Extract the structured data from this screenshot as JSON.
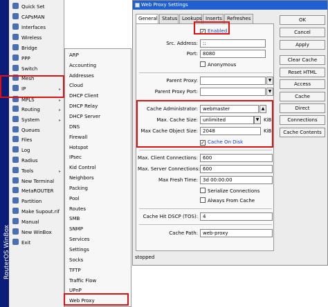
{
  "brand": {
    "text": "RouterOS WinBox"
  },
  "sidebar": {
    "items": [
      {
        "label": "Quick Set",
        "icon": "quick-set-icon"
      },
      {
        "label": "CAPsMAN",
        "icon": "capsman-icon"
      },
      {
        "label": "Interfaces",
        "icon": "interfaces-icon"
      },
      {
        "label": "Wireless",
        "icon": "wireless-icon"
      },
      {
        "label": "Bridge",
        "icon": "bridge-icon"
      },
      {
        "label": "PPP",
        "icon": "ppp-icon"
      },
      {
        "label": "Switch",
        "icon": "switch-icon"
      },
      {
        "label": "Mesh",
        "icon": "mesh-icon"
      },
      {
        "label": "IP",
        "icon": "ip-icon",
        "submenu": true
      },
      {
        "label": "MPLS",
        "icon": "mpls-icon",
        "submenu": true
      },
      {
        "label": "Routing",
        "icon": "routing-icon",
        "submenu": true
      },
      {
        "label": "System",
        "icon": "system-icon",
        "submenu": true
      },
      {
        "label": "Queues",
        "icon": "queues-icon"
      },
      {
        "label": "Files",
        "icon": "files-icon"
      },
      {
        "label": "Log",
        "icon": "log-icon"
      },
      {
        "label": "Radius",
        "icon": "radius-icon"
      },
      {
        "label": "Tools",
        "icon": "tools-icon",
        "submenu": true
      },
      {
        "label": "New Terminal",
        "icon": "terminal-icon"
      },
      {
        "label": "MetaROUTER",
        "icon": "metarouter-icon"
      },
      {
        "label": "Partition",
        "icon": "partition-icon"
      },
      {
        "label": "Make Supout.rif",
        "icon": "supout-icon"
      },
      {
        "label": "Manual",
        "icon": "manual-icon"
      },
      {
        "label": "New WinBox",
        "icon": "winbox-icon"
      },
      {
        "label": "Exit",
        "icon": "exit-icon"
      }
    ]
  },
  "submenu": {
    "items": [
      "ARP",
      "Accounting",
      "Addresses",
      "Cloud",
      "DHCP Client",
      "DHCP Relay",
      "DHCP Server",
      "DNS",
      "Firewall",
      "Hotspot",
      "IPsec",
      "Kid Control",
      "Neighbors",
      "Packing",
      "Pool",
      "Routes",
      "SMB",
      "SNMP",
      "Services",
      "Settings",
      "Socks",
      "TFTP",
      "Traffic Flow",
      "UPnP",
      "Web Proxy"
    ]
  },
  "window": {
    "title": "Web Proxy Settings",
    "tabs": [
      "General",
      "Status",
      "Lookups",
      "Inserts",
      "Refreshes"
    ],
    "enabled": {
      "label": "Enabled",
      "checked": true
    },
    "fields": {
      "src_address": {
        "label": "Src. Address:",
        "value": "::"
      },
      "port": {
        "label": "Port:",
        "value": "8080"
      },
      "parent_proxy": {
        "label": "Parent Proxy:",
        "value": ""
      },
      "parent_proxy_port": {
        "label": "Parent Proxy Port:",
        "value": ""
      },
      "cache_admin": {
        "label": "Cache Administrator:",
        "value": "webmaster"
      },
      "max_cache_size": {
        "label": "Max. Cache Size:",
        "value": "unlimited",
        "unit": "KiB"
      },
      "max_cache_object_size": {
        "label": "Max Cache Object Size:",
        "value": "2048",
        "unit": "KiB"
      },
      "max_client_conn": {
        "label": "Max. Client Connections:",
        "value": "600"
      },
      "max_server_conn": {
        "label": "Max. Server Connections:",
        "value": "600"
      },
      "max_fresh_time": {
        "label": "Max Fresh Time:",
        "value": "3d 00:00:00"
      },
      "cache_hit_dscp": {
        "label": "Cache Hit DSCP (TOS):",
        "value": "4"
      },
      "cache_path": {
        "label": "Cache Path:",
        "value": "web-proxy"
      }
    },
    "checks": {
      "anonymous": {
        "label": "Anonymous",
        "checked": false
      },
      "cache_on_disk": {
        "label": "Cache On Disk",
        "checked": true
      },
      "serialize": {
        "label": "Serialize Connections",
        "checked": false
      },
      "always_from_cache": {
        "label": "Always From Cache",
        "checked": false
      }
    },
    "buttons": [
      "OK",
      "Cancel",
      "Apply",
      "Clear Cache",
      "Reset HTML",
      "Access",
      "Cache",
      "Direct",
      "Connections",
      "Cache Contents"
    ],
    "status": "stopped"
  },
  "colors": {
    "highlight": "#e01010",
    "titlebar": "#1f5fd0",
    "brand": "#0b1d78",
    "checked_text": "#1a3fd0"
  }
}
